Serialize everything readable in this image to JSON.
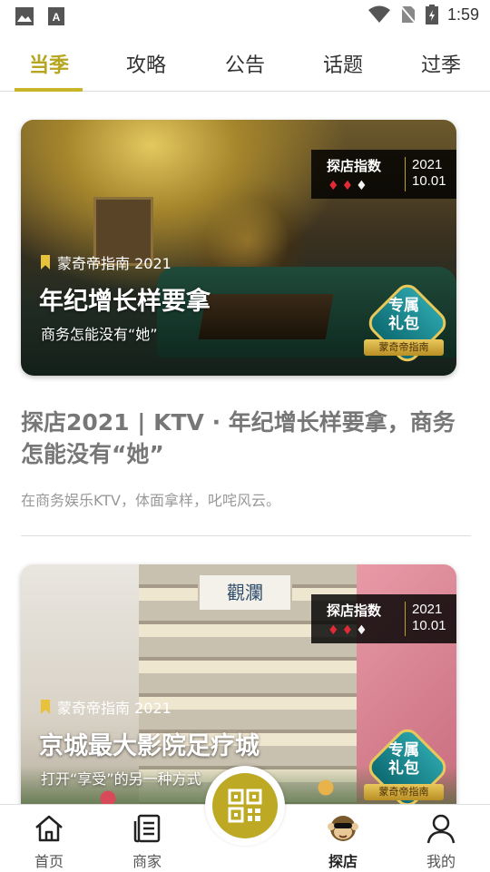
{
  "status_bar": {
    "time": "1:59"
  },
  "tabs": [
    {
      "label": "当季"
    },
    {
      "label": "攻略"
    },
    {
      "label": "公告"
    },
    {
      "label": "话题"
    },
    {
      "label": "过季"
    }
  ],
  "cards": [
    {
      "index_label": "探店指数",
      "year": "2021",
      "date": "10.01",
      "guide_tag": "蒙奇帝指南 2021",
      "title": "年纪增长样要拿",
      "subtitle": "商务怎能没有“她”",
      "gift_line1": "专属",
      "gift_line2": "礼包",
      "gift_ribbon": "蒙奇帝指南"
    },
    {
      "index_label": "探店指数",
      "year": "2021",
      "date": "10.01",
      "guide_tag": "蒙奇帝指南 2021",
      "title": "京城最大影院足疗城",
      "subtitle": "打开“享受”的另一种方式",
      "sign_text": "觀瀾",
      "gift_line1": "专属",
      "gift_line2": "礼包",
      "gift_ribbon": "蒙奇帝指南"
    }
  ],
  "article": {
    "title": "探店2021 | KTV · 年纪增长样要拿，商务怎能没有“她”",
    "description": "在商务娱乐KTV，体面拿样，叱咤风云。"
  },
  "bottom_nav": [
    {
      "label": "首页",
      "icon": "home-icon"
    },
    {
      "label": "商家",
      "icon": "document-list-icon"
    },
    {
      "label": "探店",
      "icon": "monkey-mascot-icon"
    },
    {
      "label": "我的",
      "icon": "user-icon"
    }
  ],
  "colors": {
    "accent": "#bda924",
    "gem_red": "#e02a35"
  }
}
